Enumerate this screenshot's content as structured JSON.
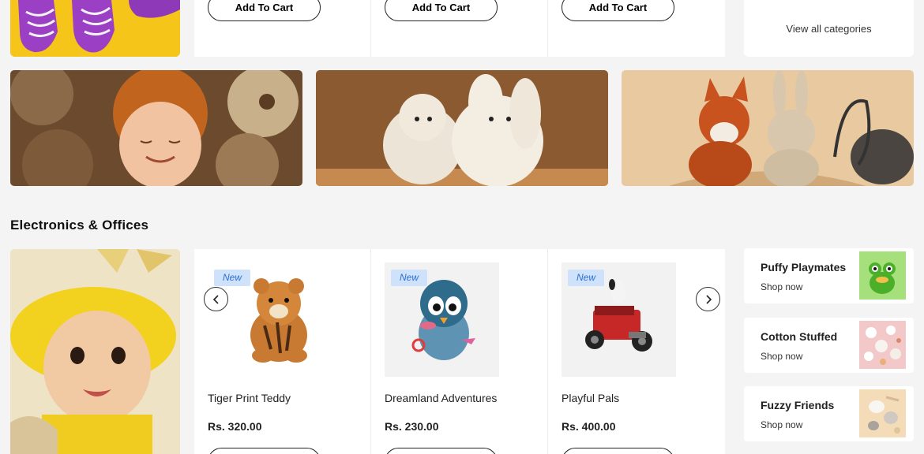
{
  "top_row": {
    "add_to_cart_labels": [
      "Add To Cart",
      "Add To Cart",
      "Add To Cart"
    ],
    "view_all_label": "View all categories"
  },
  "section": {
    "title": "Electronics & Offices"
  },
  "products": [
    {
      "badge": "New",
      "name": "Tiger Print Teddy",
      "price": "Rs. 320.00"
    },
    {
      "badge": "New",
      "name": "Dreamland Adventures",
      "price": "Rs. 230.00"
    },
    {
      "badge": "New",
      "name": "Playful Pals",
      "price": "Rs. 400.00"
    }
  ],
  "carousel": {
    "prev_icon": "chevron-left-icon",
    "next_icon": "chevron-right-icon"
  },
  "side_categories": [
    {
      "title": "Puffy Playmates",
      "link": "Shop now"
    },
    {
      "title": "Cotton Stuffed",
      "link": "Shop now"
    },
    {
      "title": "Fuzzy Friends",
      "link": "Shop now"
    }
  ],
  "colors": {
    "badge_bg": "#cfe2fb",
    "badge_text": "#2b6fd6",
    "page_bg": "#f4f4f4",
    "card_bg": "#ffffff"
  }
}
